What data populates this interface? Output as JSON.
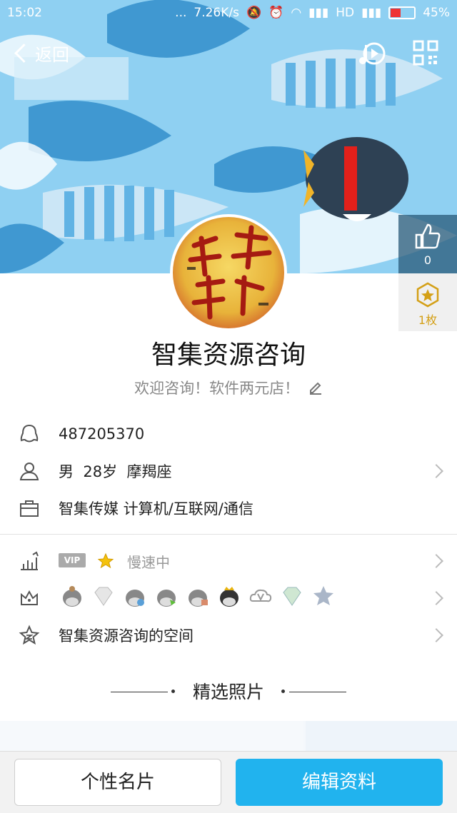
{
  "status_bar": {
    "time": "15:02",
    "dots": "...",
    "speed": "7.26K/s",
    "network": "HD",
    "battery": "45%",
    "battery_level": 0.45
  },
  "nav": {
    "back_label": "返回",
    "icons": [
      "music-icon",
      "qr-code-icon"
    ]
  },
  "likes": {
    "count": "0",
    "badge_count": "1枚"
  },
  "profile": {
    "name": "智集资源咨询",
    "signature": "欢迎咨询！软件两元店！"
  },
  "info": {
    "qq": "487205370",
    "gender": "男",
    "age": "28岁",
    "zodiac": "摩羯座",
    "company": "智集传媒 计算机/互联网/通信"
  },
  "level": {
    "vip_label": "VIP",
    "speed_status": "慢速中"
  },
  "space_label": "智集资源咨询的空间",
  "photos_title": "精选照片",
  "buttons": {
    "card": "个性名片",
    "edit": "编辑资料"
  },
  "colors": {
    "accent": "#21b3ee",
    "banner": "#8fd0f2",
    "badge_gold": "#d4a017"
  }
}
